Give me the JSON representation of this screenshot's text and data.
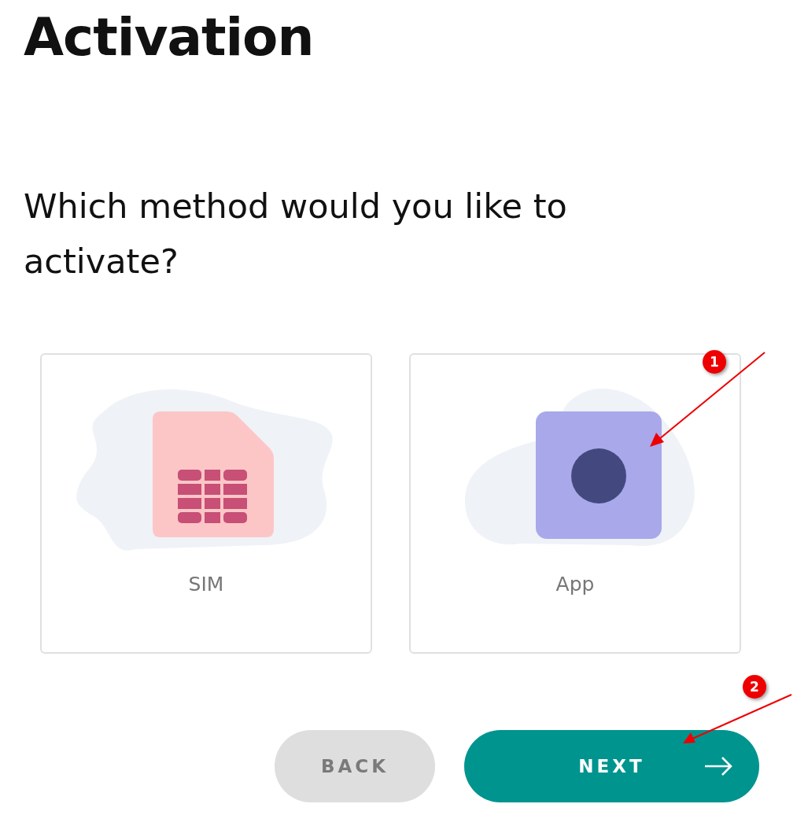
{
  "title": "Activation",
  "question": "Which method would you like to activate?",
  "methods": [
    {
      "kind": "sim",
      "label": "SIM",
      "selected": false
    },
    {
      "kind": "app",
      "label": "App",
      "selected": false
    }
  ],
  "buttons": [
    {
      "kind": "back",
      "label": "BACK"
    },
    {
      "kind": "next",
      "label": "NEXT"
    }
  ],
  "annotations": [
    {
      "label": "1"
    },
    {
      "label": "2"
    }
  ]
}
